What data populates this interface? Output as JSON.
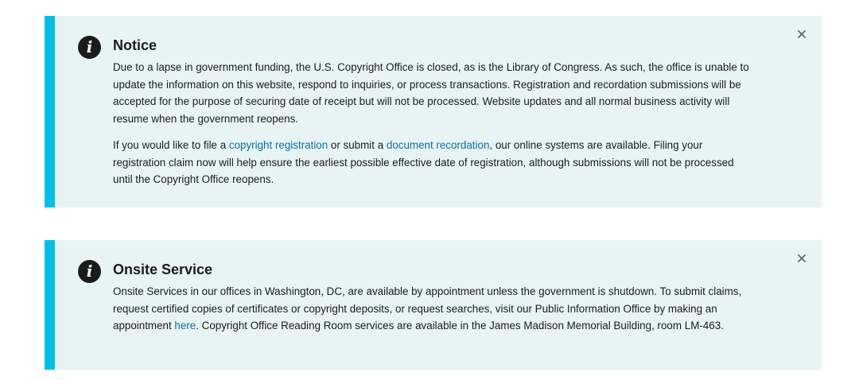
{
  "colors": {
    "accent_border": "#02bfe7",
    "alert_background": "#e8f4f4",
    "link": "#0b6fa4",
    "icon_background": "#1b1b1b"
  },
  "alerts": [
    {
      "icon": "info-icon",
      "icon_glyph": "i",
      "title": "Notice",
      "p1": "Due to a lapse in government funding, the U.S. Copyright Office is closed, as is the Library of Congress. As such, the office is unable to update the information on this website, respond to inquiries, or process transactions. Registration and recordation submissions will be accepted for the purpose of securing date of receipt but will not be processed. Website updates and all normal business activity will resume when the government reopens.",
      "p2_before": "If you would like to file a ",
      "p2_link1": "copyright registration",
      "p2_middle": " or submit a ",
      "p2_link2": "document recordation",
      "p2_after": ", our online systems are available. Filing your registration claim now will help ensure the earliest possible effective date of registration, although submissions will not be processed until the Copyright Office reopens.",
      "close_icon": "close-icon"
    },
    {
      "icon": "info-icon",
      "icon_glyph": "i",
      "title": "Onsite Service",
      "p1_before": "Onsite Services in our offices in Washington, DC, are available by appointment unless the government is shutdown. To submit claims, request certified copies of certificates or copyright deposits, or request searches, visit our Public Information Office by making an appointment ",
      "p1_link": "here",
      "p1_after": ". Copyright Office Reading Room services are available in the James Madison Memorial Building, room LM-463.",
      "close_icon": "close-icon"
    }
  ]
}
